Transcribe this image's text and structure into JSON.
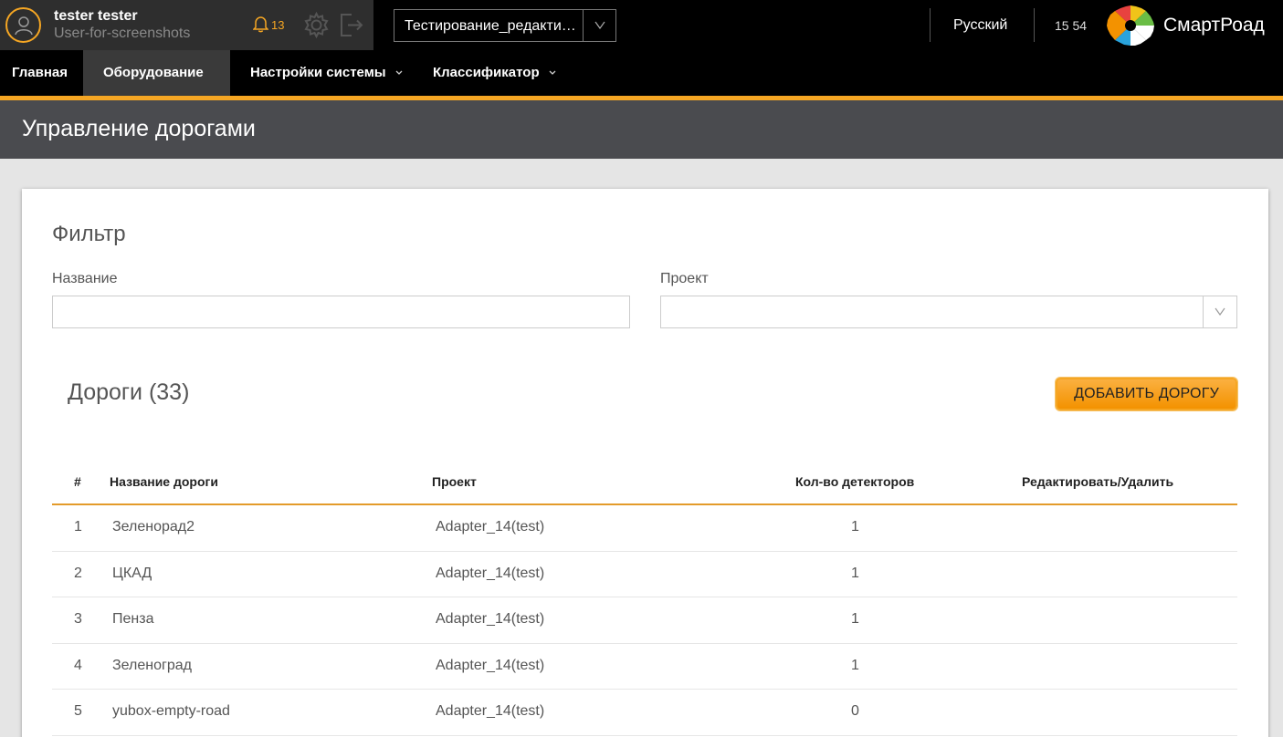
{
  "header": {
    "user_name": "tester tester",
    "user_subtitle": "User-for-screenshots",
    "notifications_count": "13",
    "project_selected": "Тестирование_редактирования",
    "language": "Русский",
    "time": "15 54",
    "brand": "СмартРоад",
    "accent_color": "#f5a623"
  },
  "menu": {
    "items": [
      {
        "label": "Главная"
      },
      {
        "label": "Оборудование"
      },
      {
        "label": "Настройки системы"
      },
      {
        "label": "Классификатор"
      }
    ]
  },
  "page": {
    "title": "Управление дорогами"
  },
  "filter": {
    "title": "Фильтр",
    "name_label": "Название",
    "name_value": "",
    "project_label": "Проект",
    "project_value": ""
  },
  "roads": {
    "title": "Дороги (33)",
    "add_button": "ДОБАВИТЬ ДОРОГУ",
    "columns": [
      "#",
      "Название дороги",
      "Проект",
      "Кол-во детекторов",
      "Редактировать/Удалить"
    ],
    "rows": [
      {
        "num": "1",
        "name": "Зеленорад2",
        "project": "Adapter_14(test)",
        "detectors": "1"
      },
      {
        "num": "2",
        "name": "ЦКАД",
        "project": "Adapter_14(test)",
        "detectors": "1"
      },
      {
        "num": "3",
        "name": "Пенза",
        "project": "Adapter_14(test)",
        "detectors": "1"
      },
      {
        "num": "4",
        "name": "Зеленоград",
        "project": "Adapter_14(test)",
        "detectors": "1"
      },
      {
        "num": "5",
        "name": "yubox-empty-road",
        "project": "Adapter_14(test)",
        "detectors": "0"
      }
    ]
  }
}
